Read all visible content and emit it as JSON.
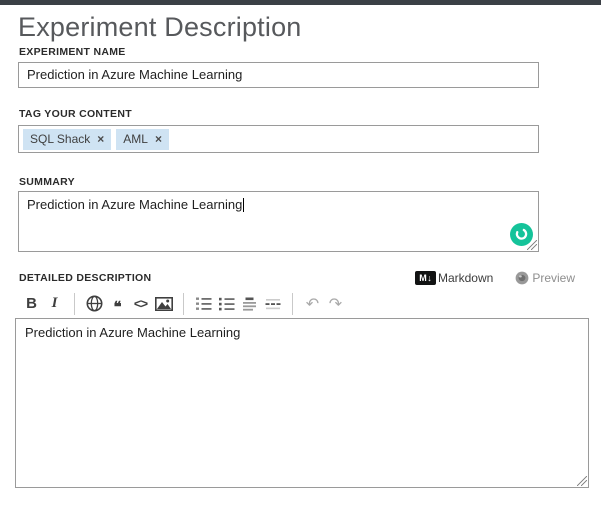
{
  "page": {
    "title": "Experiment Description"
  },
  "form": {
    "experiment_name": {
      "label": "EXPERIMENT NAME",
      "value": "Prediction in Azure Machine Learning"
    },
    "tags": {
      "label": "TAG YOUR CONTENT",
      "items": [
        {
          "text": "SQL Shack",
          "remove_glyph": "×"
        },
        {
          "text": "AML",
          "remove_glyph": "×"
        }
      ]
    },
    "summary": {
      "label": "SUMMARY",
      "value": "Prediction in Azure Machine Learning"
    },
    "detailed_description": {
      "label": "DETAILED DESCRIPTION",
      "value": "Prediction in Azure Machine Learning"
    }
  },
  "markdown_bar": {
    "logo_m": "M",
    "logo_arrow": "↓",
    "markdown_label": "Markdown",
    "preview_label": "Preview"
  },
  "toolbar": {
    "bold_glyph": "B",
    "italic_glyph": "I",
    "quote_glyph": "❝",
    "code_glyph": "<>",
    "undo_glyph": "↶",
    "redo_glyph": "↷"
  },
  "colors": {
    "top_bar": "#3b4046",
    "tag_chip_bg": "#cfe3f3",
    "grammarly_green": "#15c39a",
    "markdown_logo_bg": "#121313",
    "input_border": "#9a9a9a"
  }
}
